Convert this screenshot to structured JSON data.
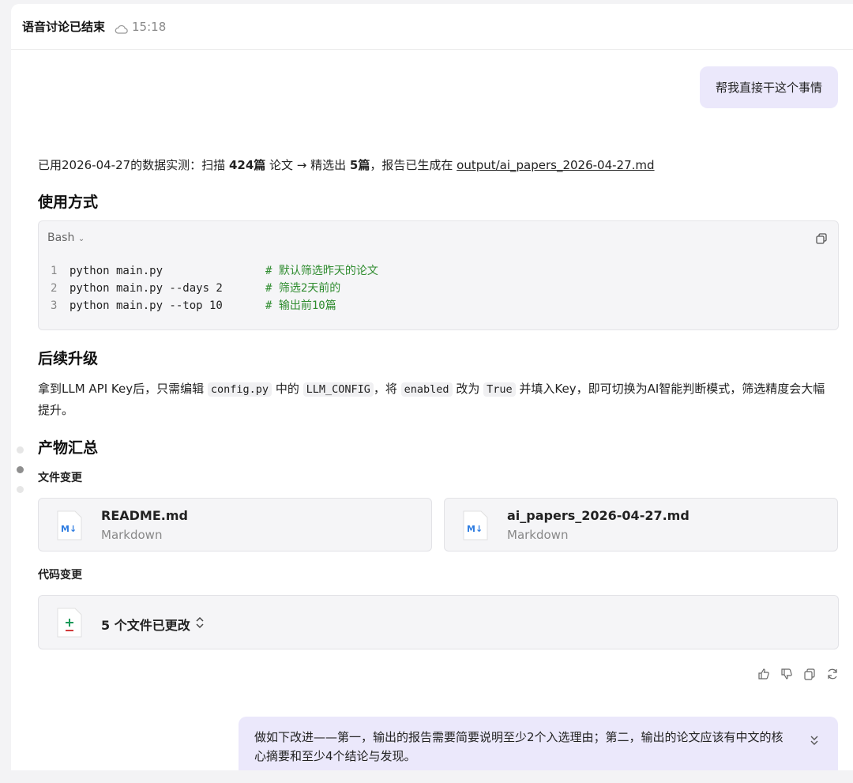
{
  "header": {
    "title": "语音讨论已结束",
    "time": "15:18",
    "icon": "cloud-icon"
  },
  "messages": {
    "user_first": "帮我直接干这个事情",
    "summary": {
      "prefix": "已用2026-04-27的数据实测：扫描 ",
      "scanned": "424篇",
      "mid1": " 论文 → 精选出 ",
      "selected": "5篇",
      "mid2": "，报告已生成在 ",
      "path": "output/ai_papers_2026-04-27.md"
    },
    "user_second": "做如下改进——第一，输出的报告需要简要说明至少2个入选理由；第二，输出的论文应该有中文的核心摘要和至少4个结论与发现。"
  },
  "usage": {
    "heading": "使用方式",
    "lang": "Bash",
    "lines": [
      {
        "n": "1",
        "cmd": "python main.py",
        "comment": "# 默认筛选昨天的论文"
      },
      {
        "n": "2",
        "cmd": "python main.py --days 2",
        "comment": "# 筛选2天前的"
      },
      {
        "n": "3",
        "cmd": "python main.py --top 10",
        "comment": "# 输出前10篇"
      }
    ]
  },
  "upgrade": {
    "heading": "后续升级",
    "t1": "拿到LLM API Key后，只需编辑 ",
    "c1": "config.py",
    "t2": " 中的 ",
    "c2": "LLM_CONFIG",
    "t3": "，将 ",
    "c3": "enabled",
    "t4": " 改为 ",
    "c4": "True",
    "t5": " 并填入Key，即可切换为AI智能判断模式，筛选精度会大幅提升。"
  },
  "artifacts": {
    "heading": "产物汇总",
    "files_heading": "文件变更",
    "files": [
      {
        "name": "README.md",
        "type": "Markdown",
        "icon": "markdown-icon"
      },
      {
        "name": "ai_papers_2026-04-27.md",
        "type": "Markdown",
        "icon": "markdown-icon"
      }
    ],
    "code_heading": "代码变更",
    "code_summary": "5 个文件已更改"
  },
  "colors": {
    "accent_bubble": "#ebe8fb",
    "comment": "#2f8c2f",
    "md_blue": "#2f7de1"
  }
}
